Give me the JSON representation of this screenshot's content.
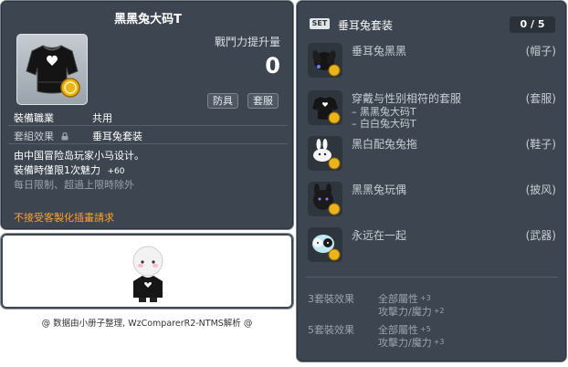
{
  "item_id": "01053650",
  "item": {
    "name": "黑黑兔大码T",
    "power_label": "戰鬥力提升量",
    "power_value": "0",
    "tags": [
      "防具",
      "套服"
    ],
    "job_label": "裝備職業",
    "job_value": "共用",
    "set_label": "套組效果",
    "set_value": "垂耳兔套装",
    "desc_lines": [
      "由中国冒险岛玩家小马设计。",
      "裝備時僅限1次魅力",
      "每日限制、超過上限時除外"
    ],
    "charm_bonus": "+60",
    "warning": "不接受客製化插畫請求"
  },
  "credit": "@ 数据由小册子整理, WzComparerR2-NTMS解析 @",
  "set": {
    "badge": "SET",
    "name": "垂耳兔套装",
    "owned": "0",
    "total": "/ 5",
    "pieces": [
      {
        "name": "垂耳兔黑黑",
        "category": "(帽子)",
        "subs": []
      },
      {
        "name": "穿戴与性别相符的套服",
        "category": "(套服)",
        "subs": [
          "– 黑黑兔大码T",
          "– 白白兔大码T"
        ]
      },
      {
        "name": "黑白配兔兔拖",
        "category": "(鞋子)",
        "subs": []
      },
      {
        "name": "黑黑兔玩偶",
        "category": "(披风)",
        "subs": []
      },
      {
        "name": "永远在一起",
        "category": "(武器)",
        "subs": []
      }
    ],
    "effects": [
      {
        "label": "3套裝效果",
        "line1": "全部屬性",
        "line1_val": "+3",
        "line2": "攻擊力/魔力",
        "line2_val": "+2"
      },
      {
        "label": "5套裝效果",
        "line1": "全部屬性",
        "line1_val": "+5",
        "line2": "攻擊力/魔力",
        "line2_val": "+3"
      }
    ]
  },
  "colors": {
    "panel_bg": "#3d4650",
    "panel_border": "#78808a",
    "warning": "#ff9f2e",
    "muted": "#9aa2ab"
  },
  "icons": [
    "lock-icon",
    "coin-icon",
    "shirt-icon",
    "hat-icon",
    "bunny-slipper-icon",
    "plush-cape-icon",
    "weapon-icon",
    "character-avatar"
  ]
}
